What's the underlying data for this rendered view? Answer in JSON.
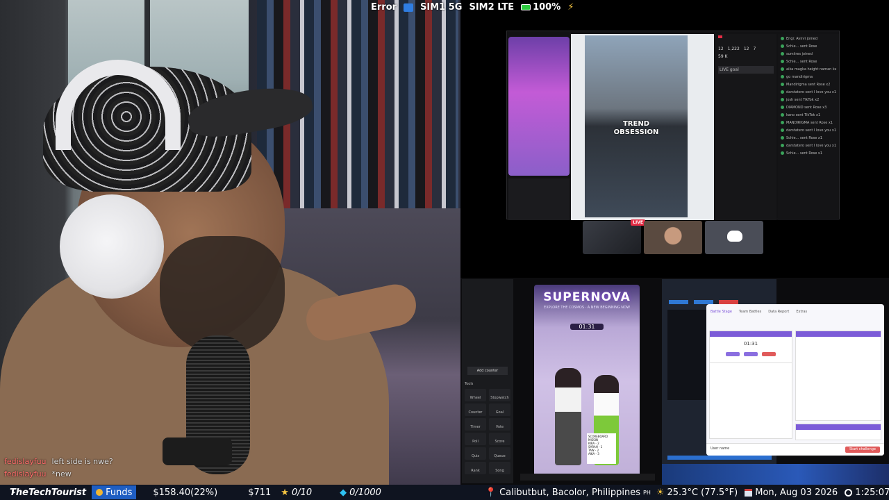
{
  "status_bar": {
    "error_label": "Error",
    "sim1": "SIM1",
    "sim1_network": "5G",
    "sim2": "SIM2",
    "sim2_network": "LTE",
    "battery": "100%"
  },
  "chat": [
    {
      "user": "fedislayfuu",
      "message": "left side is nwe?"
    },
    {
      "user": "fedislayfuu",
      "message": "*new"
    }
  ],
  "screen_top": {
    "video_caption_line1": "TREND",
    "video_caption_line2": "OBSESSION",
    "live_badge": "LIVE",
    "stats": {
      "viewers": "12",
      "likes": "1,222",
      "gifts": "12",
      "diamonds": "7",
      "followers": "59 K"
    },
    "live_goal": "LIVE goal",
    "feed": [
      "Engr. Avirvi joined",
      "Schie... sent Rose",
      "sumiires joined",
      "Schie... sent Rose",
      "aika magka height naman kayo diba hahaa",
      "go mandirigma",
      "Mandirigma sent Rose x2",
      "darstatero sent I love you x1",
      "josh sent TikTok x2",
      "DIAMOND sent Rose x3",
      "kano sent TikTok x1",
      "MANDIRIGMA sent Rose x1",
      "darstatero sent I love you x1",
      "Schie... sent Rose x1",
      "darstatero sent I love you x1",
      "Schie... sent Rose x1"
    ]
  },
  "screen_bot": {
    "phone_title": "SUPERNOVA",
    "phone_sub": "EXPLORE THE COSMOS · A NEW BEGINNING NOW",
    "timer": "01:31",
    "scoreboard": [
      "SCOREBOARD",
      "MISSIN",
      "KIRA - 2",
      "SARAH - 1",
      "TAW - 2",
      "AIKA - 3"
    ],
    "add_counter": "Add counter",
    "tools_label": "Tools",
    "tools": [
      "Wheel",
      "Stopwatch",
      "Counter",
      "Goal",
      "Timer",
      "Vote",
      "Poll",
      "Score",
      "Quiz",
      "Queue",
      "Rank",
      "Song"
    ],
    "modal_tabs": [
      "Battle Stage",
      "Team Battles",
      "Data Report",
      "Extras"
    ],
    "modal_timer": "01:31",
    "modal_footer_left": "User name",
    "modal_footer_button": "Start challenge"
  },
  "ticker": {
    "channel": "TheTechTourist",
    "funds_label": "Funds",
    "balance": "$158.40(22%)",
    "target": "$711",
    "stars": "0/10",
    "gems": "0/1000",
    "location": "Calibutbut, Bacolor, Philippines",
    "country_code": "PH",
    "temperature": "25.3°C (77.5°F)",
    "date": "Mon, Aug 03 2026",
    "time": "1:25:07 PM"
  },
  "colors": {
    "ticker_bg": "#0f1420",
    "funds_bg": "#1f5ec2",
    "live_red": "#e52d45",
    "modal_accent": "#7c5cd8"
  },
  "icons": [
    "wifi-icon",
    "battery-icon",
    "charging-icon",
    "youtube-icon",
    "funds-bag-icon",
    "star-icon",
    "gem-icon",
    "location-pin-icon",
    "sun-icon",
    "calendar-icon",
    "clock-icon",
    "discord-icon"
  ]
}
